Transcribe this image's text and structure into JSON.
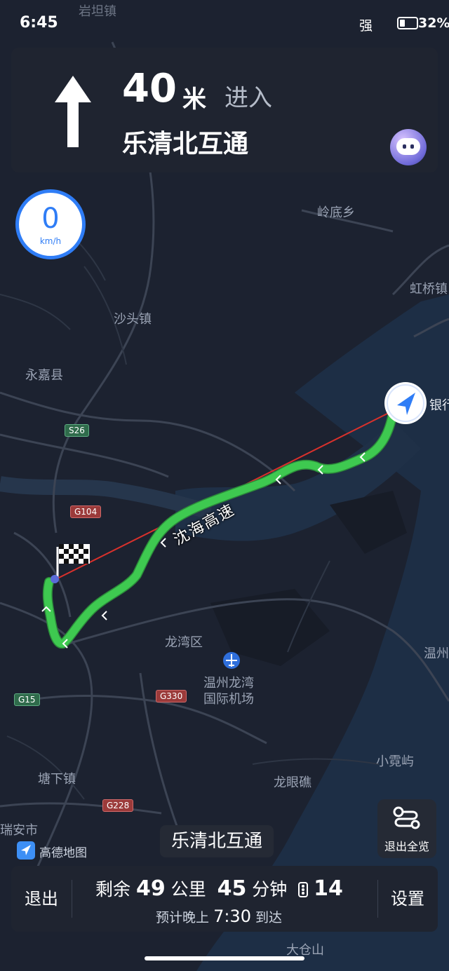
{
  "status_bar": {
    "time": "6:45",
    "signal_label": "强",
    "battery_percent": 32,
    "battery_text": "32%"
  },
  "navigation": {
    "turn_direction": "straight-arrow-icon",
    "distance_value": "40",
    "distance_unit": "米",
    "action": "进入",
    "road_name": "乐清北互通"
  },
  "speed": {
    "value": "0",
    "unit": "km/h"
  },
  "map": {
    "place_labels": [
      "岩坦镇",
      "岭底乡",
      "虹桥镇",
      "沙头镇",
      "永嘉县",
      "龙湾区",
      "温州龙湾",
      "国际机场",
      "温州",
      "小霓屿",
      "塘下镇",
      "龙眼礁",
      "瑞安市",
      "大仓山",
      "银行"
    ],
    "route_road_label": "沈海高速",
    "road_shields": [
      {
        "code": "S26",
        "color": "green"
      },
      {
        "code": "G104",
        "color": "red"
      },
      {
        "code": "G15",
        "color": "green"
      },
      {
        "code": "G330",
        "color": "red"
      },
      {
        "code": "G228",
        "color": "red"
      }
    ],
    "route_color": "#3ec950",
    "straight_line_color": "#d9312c"
  },
  "next_road": "乐清北互通",
  "overview_button": {
    "label": "退出全览"
  },
  "brand": {
    "logo_text": "高德地图"
  },
  "bottom_bar": {
    "exit_label": "退出",
    "remain_prefix": "剩余",
    "remain_distance": "49",
    "remain_distance_unit": "公里",
    "remain_time": "45",
    "remain_time_unit": "分钟",
    "traffic_lights": "14",
    "eta_prefix": "预计晚上",
    "eta_time": "7:30",
    "eta_suffix": "到达",
    "settings_label": "设置"
  }
}
